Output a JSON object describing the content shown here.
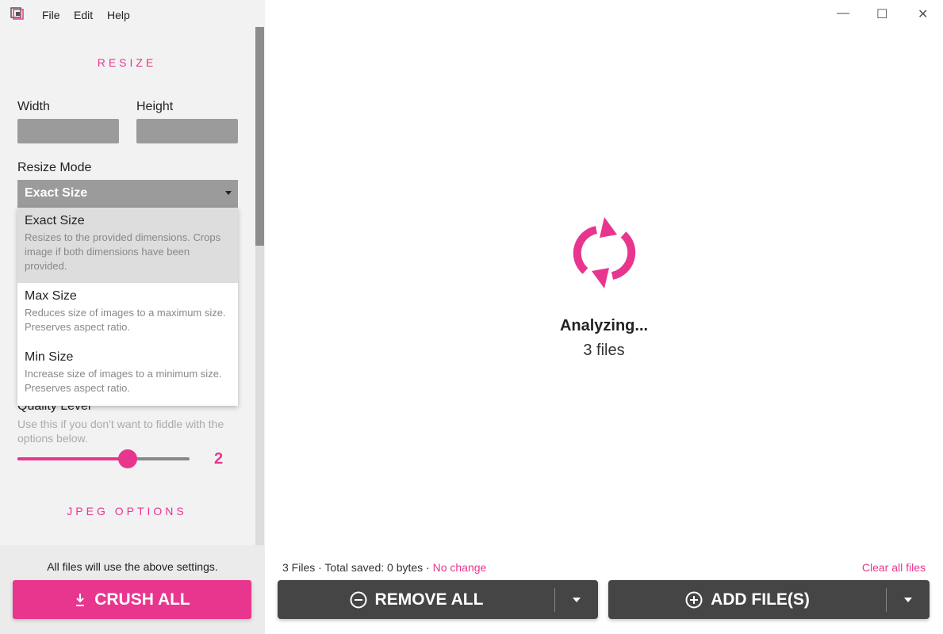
{
  "menu": [
    "File",
    "Edit",
    "Help"
  ],
  "window_controls": {
    "minimize": "—",
    "maximize": "☐",
    "close": "✕"
  },
  "sidebar": {
    "resize_title": "RESIZE",
    "width_label": "Width",
    "height_label": "Height",
    "width_value": "",
    "height_value": "",
    "resize_mode_label": "Resize Mode",
    "resize_mode_selected": "Exact Size",
    "options": [
      {
        "title": "Exact Size",
        "desc": "Resizes to the provided dimensions. Crops image if both dimensions have been provided."
      },
      {
        "title": "Max Size",
        "desc": "Reduces size of images to a maximum size. Preserves aspect ratio."
      },
      {
        "title": "Min Size",
        "desc": "Increase size of images to a minimum size. Preserves aspect ratio."
      }
    ],
    "quality_label": "Quality Level",
    "quality_desc": "Use this if you don't want to fiddle with the options below.",
    "quality_value": "2",
    "quality_fraction": 0.64,
    "jpeg_title": "JPEG OPTIONS",
    "footer_note": "All files will use the above settings.",
    "crush_label": "CRUSH ALL"
  },
  "main": {
    "status_title": "Analyzing...",
    "status_count": "3 files",
    "summary": "3 Files · Total saved: 0 bytes · ",
    "summary_change": "No change",
    "clear_label": "Clear all files",
    "remove_label": "REMOVE ALL",
    "add_label": "ADD FILE(S)"
  },
  "colors": {
    "accent": "#e8368f",
    "button_dark": "#454545"
  }
}
